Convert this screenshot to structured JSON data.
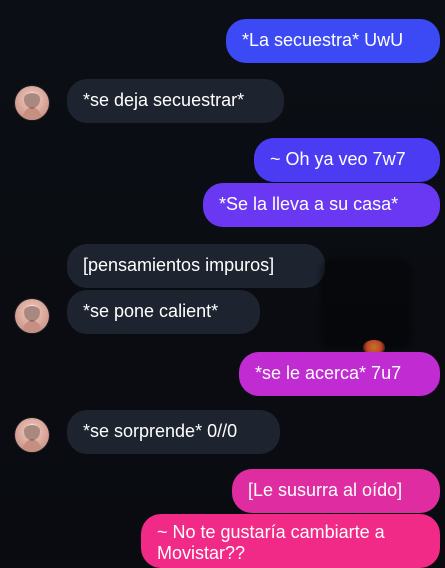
{
  "chat": {
    "messages": [
      {
        "side": "out",
        "text": "*La secuestra* UwU",
        "color": "#3b4af5"
      },
      {
        "side": "in",
        "text": "*se deja secuestrar*",
        "color": "#1d2430"
      },
      {
        "side": "out",
        "text": "~ Oh ya veo 7w7",
        "color": "#4b3cf4"
      },
      {
        "side": "out",
        "text": "*Se la lleva a su casa*",
        "color": "#6a38f2"
      },
      {
        "side": "in",
        "text": "[pensamientos impuros]",
        "color": "#1d2430"
      },
      {
        "side": "in",
        "text": "*se pone calient*",
        "color": "#1d2430"
      },
      {
        "side": "out",
        "text": "*se le acerca* 7u7",
        "color": "#c12bd2"
      },
      {
        "side": "in",
        "text": "*se sorprende* 0//0",
        "color": "#1d2430"
      },
      {
        "side": "out",
        "text": "[Le susurra al oído]",
        "color": "#e02ca1"
      },
      {
        "side": "out",
        "text": "~ No te gustaría cambiarte a Movistar??",
        "color": "#f02a86"
      }
    ]
  },
  "icons": {
    "avatar": "avatar-icon",
    "emoji_peek": "emoji-peek-icon"
  }
}
